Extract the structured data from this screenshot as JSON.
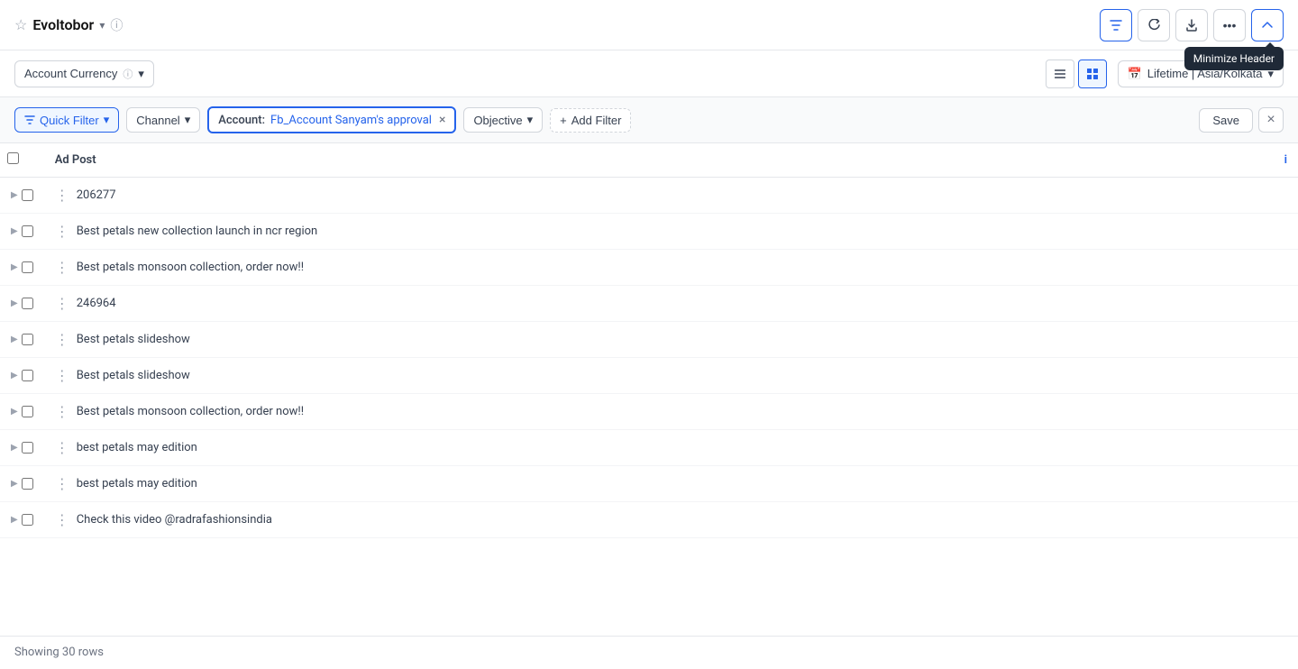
{
  "header": {
    "app_name": "Evoltobor",
    "filter_btn_label": "Filter",
    "refresh_label": "Refresh",
    "export_label": "Export",
    "more_label": "More",
    "minimize_header_label": "Minimize Header",
    "tooltip_text": "Minimize Header"
  },
  "subheader": {
    "account_currency_label": "Account Currency",
    "info_symbol": "ⓘ",
    "view_list_label": "List view",
    "view_grid_label": "Grid view",
    "date_range_label": "Lifetime | Asia/Kolkata"
  },
  "filter_bar": {
    "quick_filter_label": "Quick Filter",
    "channel_label": "Channel",
    "account_label": "Account:",
    "account_value": "Fb_Account Sanyam's approval",
    "objective_label": "Objective",
    "add_filter_label": "Add Filter",
    "save_label": "Save"
  },
  "table": {
    "header": {
      "ad_post": "Ad Post",
      "info_icon": "i"
    },
    "rows": [
      {
        "id": 1,
        "name": "206277"
      },
      {
        "id": 2,
        "name": "Best petals new collection launch in ncr region"
      },
      {
        "id": 3,
        "name": "Best petals monsoon collection, order now!!"
      },
      {
        "id": 4,
        "name": "246964"
      },
      {
        "id": 5,
        "name": "Best petals slideshow"
      },
      {
        "id": 6,
        "name": "Best petals slideshow"
      },
      {
        "id": 7,
        "name": "Best petals monsoon collection, order now!!"
      },
      {
        "id": 8,
        "name": "best petals may edition"
      },
      {
        "id": 9,
        "name": "best petals may edition"
      },
      {
        "id": 10,
        "name": "Check this video @radrafashionsindia"
      }
    ]
  },
  "footer": {
    "showing_label": "Showing 30 rows"
  }
}
